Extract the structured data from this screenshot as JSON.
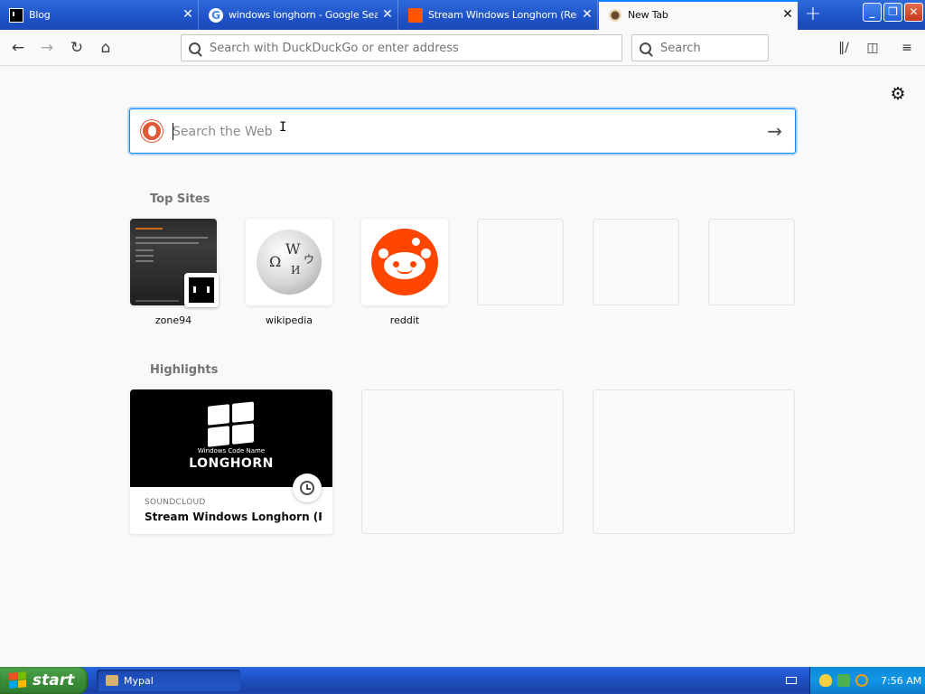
{
  "tabs": [
    {
      "label": "Blog",
      "icon": "blog-favicon"
    },
    {
      "label": "windows longhorn - Google Search",
      "icon": "google-favicon"
    },
    {
      "label": "Stream Windows Longhorn (Remix)",
      "icon": "soundcloud-favicon"
    },
    {
      "label": "New Tab",
      "icon": "newtab-favicon",
      "active": true
    }
  ],
  "tab_close_glyph": "✕",
  "new_tab_glyph": "+",
  "window_controls": {
    "minimize": "_",
    "restore": "❐",
    "close": "✕"
  },
  "navbar": {
    "url_placeholder": "Search with DuckDuckGo or enter address",
    "search_placeholder": "Search"
  },
  "content": {
    "web_search_placeholder": "Search the Web",
    "go_glyph": "→",
    "top_sites_title": "Top Sites",
    "top_sites": [
      {
        "label": "zone94"
      },
      {
        "label": "wikipedia"
      },
      {
        "label": "reddit"
      }
    ],
    "highlights_title": "Highlights",
    "highlight": {
      "image_line1": "Windows Code Name",
      "image_line2": "LONGHORN",
      "source": "SOUNDCLOUD",
      "title": "Stream Windows Longhorn (Re..."
    }
  },
  "taskbar": {
    "start_label": "start",
    "task_label": "Mypal",
    "time": "7:56 AM"
  },
  "colors": {
    "accent": "#0a84ff",
    "xp_blue": "#245edb",
    "start_green": "#3c8e39",
    "reddit": "#ff4500",
    "soundcloud": "#ff5500",
    "duckduckgo": "#de5833"
  }
}
